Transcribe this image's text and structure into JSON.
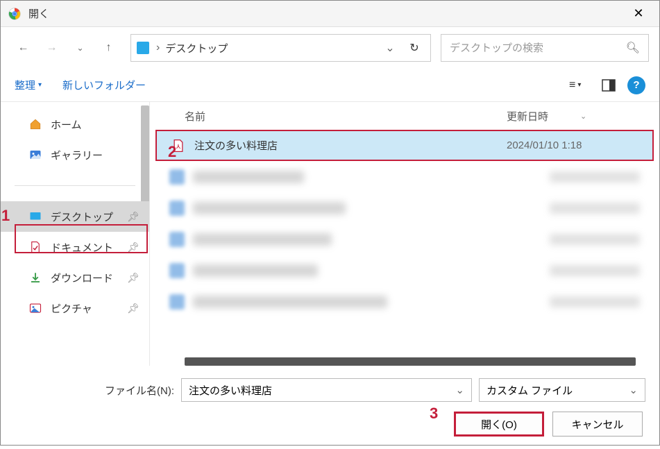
{
  "window": {
    "title": "開く"
  },
  "breadcrumb": {
    "location": "デスクトップ"
  },
  "search": {
    "placeholder": "デスクトップの検索"
  },
  "toolbar": {
    "organize": "整理",
    "new_folder": "新しいフォルダー"
  },
  "sidebar": {
    "items": [
      {
        "label": "ホーム",
        "icon": "home"
      },
      {
        "label": "ギャラリー",
        "icon": "gallery"
      },
      {
        "label": "デスクトップ",
        "icon": "desktop",
        "selected": true,
        "pinned": true
      },
      {
        "label": "ドキュメント",
        "icon": "document",
        "pinned": true
      },
      {
        "label": "ダウンロード",
        "icon": "download",
        "pinned": true
      },
      {
        "label": "ピクチャ",
        "icon": "picture",
        "pinned": true
      }
    ]
  },
  "file_list": {
    "columns": {
      "name": "名前",
      "date": "更新日時"
    },
    "selected_file": {
      "name": "注文の多い料理店",
      "date": "2024/01/10 1:18"
    }
  },
  "footer": {
    "filename_label": "ファイル名(N):",
    "filename_value": "注文の多い料理店",
    "filetype_value": "カスタム ファイル",
    "open_button": "開く(O)",
    "cancel_button": "キャンセル"
  },
  "callouts": {
    "c1": "1",
    "c2": "2",
    "c3": "3"
  }
}
